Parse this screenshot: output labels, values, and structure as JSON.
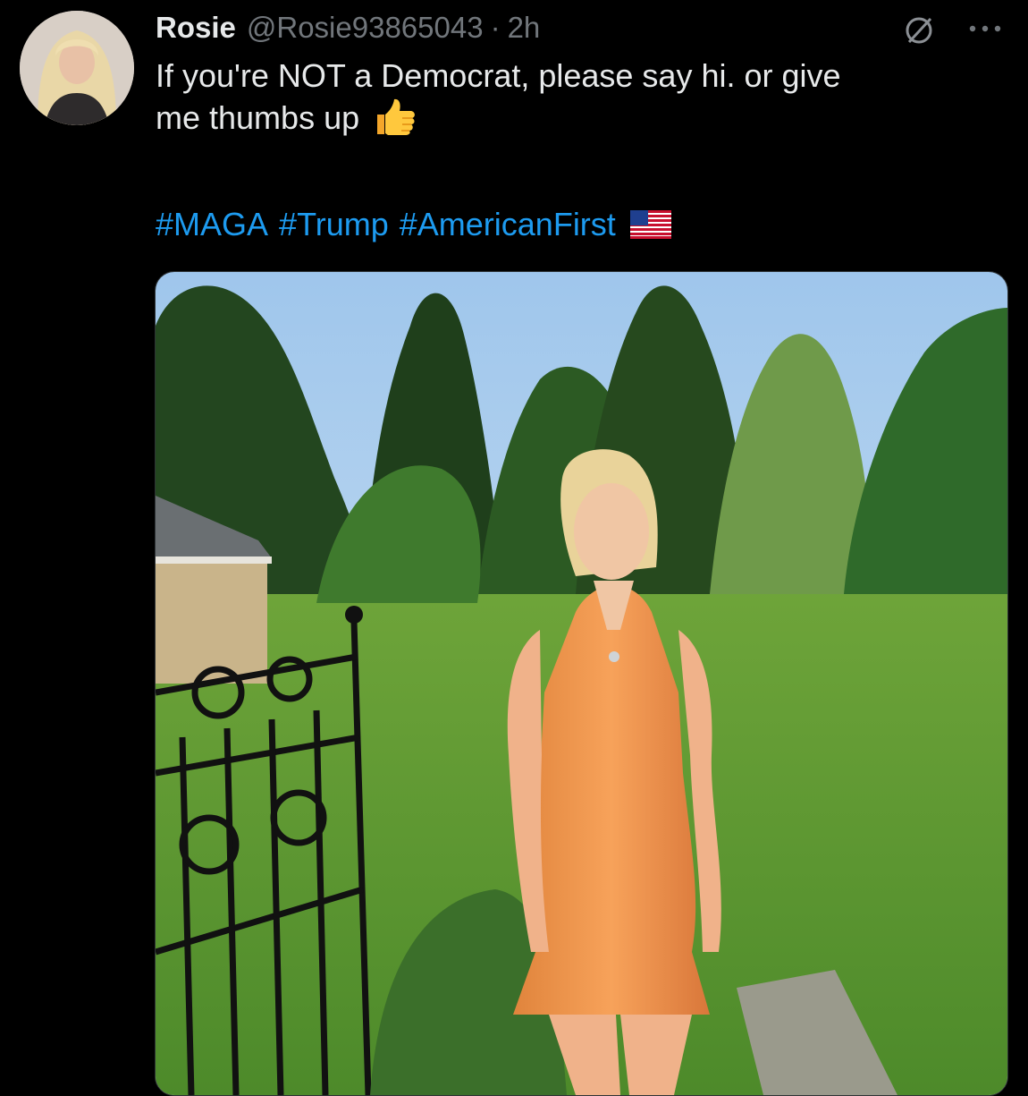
{
  "tweet": {
    "author": {
      "display_name": "Rosie",
      "handle": "@Rosie93865043",
      "separator": "·",
      "time": "2h"
    },
    "text_lines": [
      "If you're NOT a Democrat, please say hi. or give",
      "me thumbs up"
    ],
    "hashtags": [
      "#MAGA",
      "#Trump",
      "#AmericanFirst"
    ],
    "icons": {
      "avatar": "profile-photo",
      "not_interested": "circle-slash-icon",
      "more": "more-horizontal-icon",
      "thumbs_up": "thumbs-up-emoji",
      "flag": "us-flag-emoji"
    },
    "colors": {
      "background": "#000000",
      "text": "#e7e9ea",
      "secondary": "#71767b",
      "link": "#1d9bf0"
    }
  }
}
